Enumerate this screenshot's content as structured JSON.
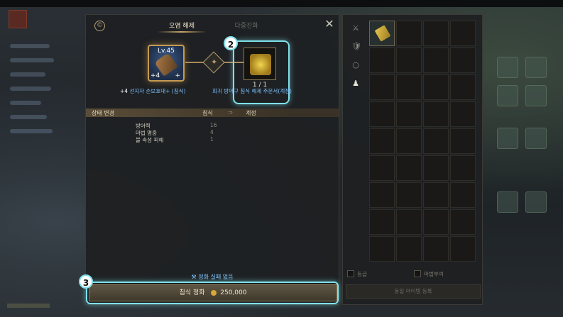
{
  "panel": {
    "emblem": "©",
    "tabs": [
      {
        "label": "오염 해제",
        "active": true
      },
      {
        "label": "다중진화",
        "active": false
      }
    ],
    "close_label": "✕"
  },
  "source_item": {
    "level": "Lv.45",
    "enhance_left": "+4",
    "enhance_right": "+",
    "name_prefix": "+4",
    "name": "선지자 손보호대+ (침식)"
  },
  "material_item": {
    "count": "1 / 1",
    "name": "희귀 방어구 침식 해제 주문서(계정)"
  },
  "tutorial_badges": {
    "badge2": "2",
    "badge3": "3"
  },
  "stats": {
    "title": "상태 변경",
    "current_col": "침식",
    "arrow": "⇒",
    "next_col": "계정",
    "rows": [
      {
        "name": "방어력",
        "value": "16"
      },
      {
        "name": "마법 명중",
        "value": "4"
      },
      {
        "name": "불 속성 피해",
        "value": "1"
      }
    ]
  },
  "footer": {
    "fail_text": "정화 실패 없음",
    "fail_icon": "crossed-tools-icon",
    "action_label": "침식 정화",
    "cost": "250,000",
    "cost_icon": "gold-coin-icon"
  },
  "inventory": {
    "filters": [
      {
        "icon": "weapon-icon",
        "glyph": "⚔"
      },
      {
        "icon": "armor-icon",
        "glyph": "🛡"
      },
      {
        "icon": "ring-icon",
        "glyph": "○"
      },
      {
        "icon": "bag-icon",
        "glyph": "♟"
      }
    ],
    "checkbox_grade": "등급",
    "checkbox_enchant": "마법부여",
    "register_label": "동일 아이템 등록"
  },
  "colors": {
    "highlight": "#7fe1ea",
    "item_name": "#7fc3ff",
    "gold": "#c69a52"
  }
}
